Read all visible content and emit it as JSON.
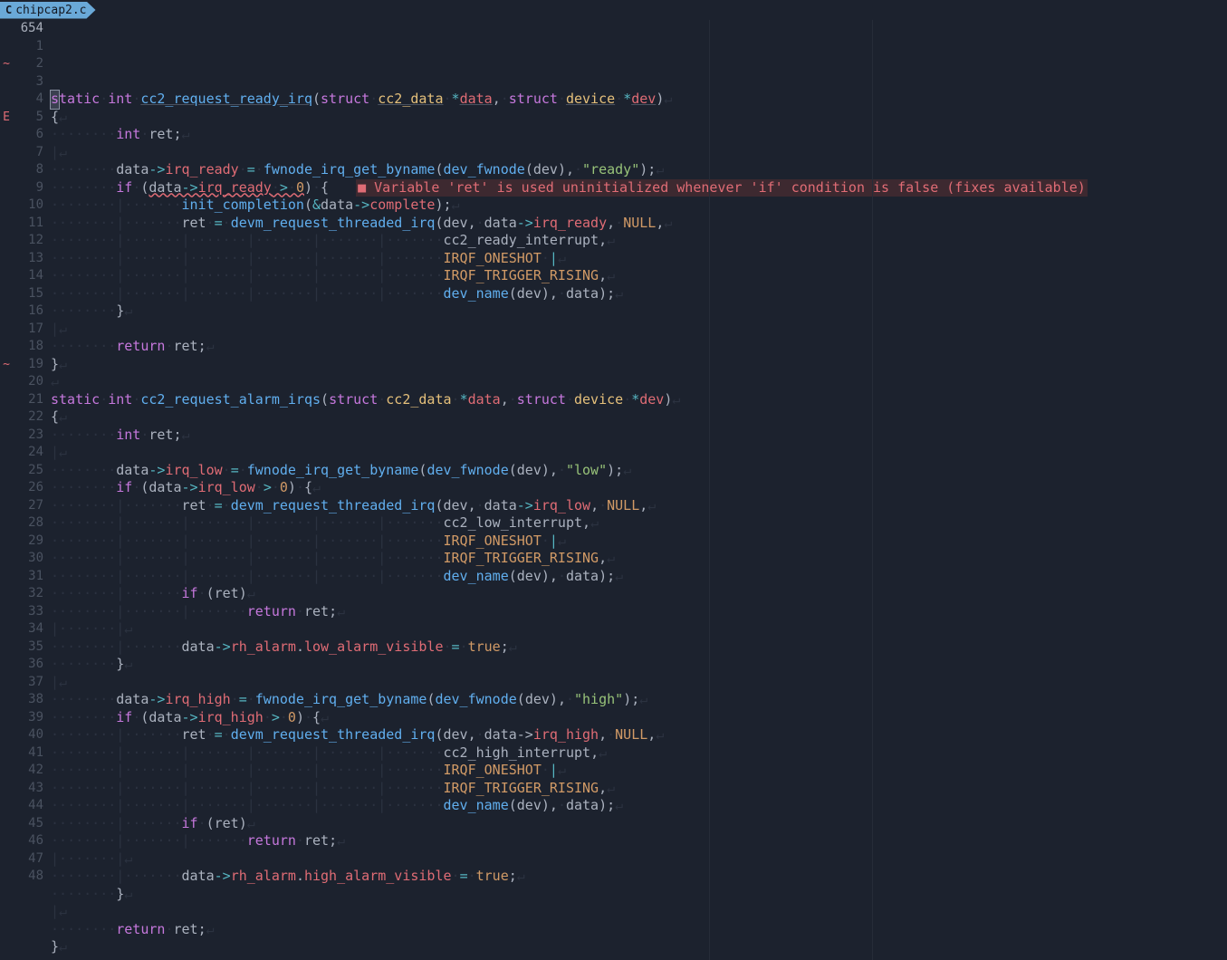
{
  "tab": {
    "icon": "C",
    "filename": "chipcap2.c"
  },
  "first_line_number": "654",
  "signs": [
    "",
    "~",
    "",
    "",
    "E",
    "",
    "",
    "",
    "",
    "",
    "",
    "",
    "",
    "",
    "",
    "",
    "",
    "",
    "~",
    "",
    "",
    "",
    "",
    "",
    "",
    "",
    "",
    "",
    "",
    "",
    "",
    "",
    "",
    "",
    "",
    "",
    "",
    "",
    "",
    "",
    "",
    "",
    "",
    "",
    "",
    "",
    "",
    ""
  ],
  "line_numbers": [
    "1",
    "2",
    "3",
    "4",
    "5",
    "6",
    "7",
    "8",
    "9",
    "10",
    "11",
    "12",
    "13",
    "14",
    "15",
    "16",
    "17",
    "18",
    "19",
    "20",
    "21",
    "22",
    "23",
    "24",
    "25",
    "26",
    "27",
    "28",
    "29",
    "30",
    "31",
    "32",
    "33",
    "34",
    "35",
    "36",
    "37",
    "38",
    "39",
    "40",
    "41",
    "42",
    "43",
    "44",
    "45",
    "46",
    "47",
    "48"
  ],
  "diagnostic": "Variable 'ret' is used uninitialized whenever 'if' condition is false (fixes available)",
  "code": {
    "l0": {
      "s": "s",
      "tatic": "tatic",
      "int": "int",
      "fn": "cc2_request_ready_irq",
      "struct": "struct",
      "t1": "cc2_data",
      "p1": "data",
      "t2": "device",
      "p2": "dev"
    },
    "l1": "{",
    "l2": {
      "int": "int",
      "ret": "ret"
    },
    "l4_a": {
      "d": "data",
      "arrow": "->",
      "f": "irq_ready",
      "eq": "=",
      "fn": "fwnode_irq_get_byname",
      "fn2": "dev_fwnode",
      "dev": "dev",
      "s": "\"ready\""
    },
    "l5": {
      "if": "if",
      "d": "data",
      "arrow": "->",
      "f": "irq_ready",
      "gt": ">",
      "z": "0"
    },
    "l6": {
      "fn": "init_completion",
      "d": "data",
      "arrow": "->",
      "c": "complete"
    },
    "l7": {
      "ret": "ret",
      "eq": "=",
      "fn": "devm_request_threaded_irq",
      "dev": "dev",
      "d": "data",
      "arrow": "->",
      "ir": "irq_ready",
      "null": "NULL"
    },
    "l8": "cc2_ready_interrupt",
    "l9": "IRQF_ONESHOT",
    "l10": "IRQF_TRIGGER_RISING",
    "l11": {
      "fn": "dev_name",
      "dev": "dev",
      "d": "data"
    },
    "l12": "}",
    "l14": {
      "return": "return",
      "ret": "ret"
    },
    "l15": "}",
    "l17": {
      "static": "static",
      "int": "int",
      "fn": "cc2_request_alarm_irqs",
      "struct": "struct",
      "t1": "cc2_data",
      "p1": "data",
      "t2": "device",
      "p2": "dev"
    },
    "l18": "{",
    "l19": {
      "int": "int",
      "ret": "ret"
    },
    "l21": {
      "d": "data",
      "arrow": "->",
      "f": "irq_low",
      "eq": "=",
      "fn": "fwnode_irq_get_byname",
      "fn2": "dev_fwnode",
      "dev": "dev",
      "s": "\"low\""
    },
    "l22": {
      "if": "if",
      "d": "data",
      "arrow": "->",
      "f": "irq_low",
      "gt": ">",
      "z": "0"
    },
    "l23": {
      "ret": "ret",
      "eq": "=",
      "fn": "devm_request_threaded_irq",
      "dev": "dev",
      "d": "data",
      "arrow": "->",
      "ir": "irq_low",
      "null": "NULL"
    },
    "l24": "cc2_low_interrupt",
    "l25": "IRQF_ONESHOT",
    "l26": "IRQF_TRIGGER_RISING",
    "l27": {
      "fn": "dev_name",
      "dev": "dev",
      "d": "data"
    },
    "l28": {
      "if": "if",
      "ret": "ret"
    },
    "l29": {
      "return": "return",
      "ret": "ret"
    },
    "l31": {
      "d": "data",
      "arrow": "->",
      "ra": "rh_alarm",
      "lav": "low_alarm_visible",
      "eq": "=",
      "t": "true"
    },
    "l32": "}",
    "l34": {
      "d": "data",
      "arrow": "->",
      "f": "irq_high",
      "eq": "=",
      "fn": "fwnode_irq_get_byname",
      "fn2": "dev_fwnode",
      "dev": "dev",
      "s": "\"high\""
    },
    "l35": {
      "if": "if",
      "d": "data",
      "arrow": "->",
      "f": "irq_high",
      "gt": ">",
      "z": "0"
    },
    "l36": {
      "ret": "ret",
      "eq": "=",
      "fn": "devm_request_threaded_irq",
      "dev": "dev",
      "d": "data",
      "arrow": "->",
      "ir": "irq_high",
      "null": "NULL"
    },
    "l37": "cc2_high_interrupt",
    "l38": "IRQF_ONESHOT",
    "l39": "IRQF_TRIGGER_RISING",
    "l40": {
      "fn": "dev_name",
      "dev": "dev",
      "d": "data"
    },
    "l41": {
      "if": "if",
      "ret": "ret"
    },
    "l42": {
      "return": "return",
      "ret": "ret"
    },
    "l44": {
      "d": "data",
      "arrow": "->",
      "ra": "rh_alarm",
      "hav": "high_alarm_visible",
      "eq": "=",
      "t": "true"
    },
    "l45": "}",
    "l47": {
      "return": "return",
      "ret": "ret"
    },
    "l48": "}"
  }
}
